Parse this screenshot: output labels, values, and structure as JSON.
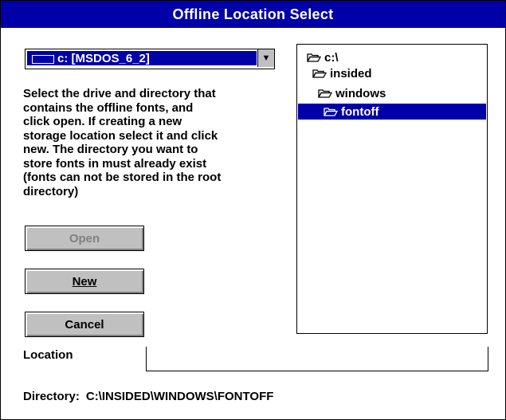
{
  "window": {
    "title": "Offline Location Select"
  },
  "drive": {
    "selected": "c: [MSDOS_6_2]",
    "icon": "drive-icon"
  },
  "instructions": "Select the drive and directory that\ncontains the offline fonts, and\nclick open.  If creating a new\nstorage location select it and click\nnew.  The directory you want to\nstore fonts in must already exist\n(fonts can not be stored in the root\ndirectory)",
  "buttons": {
    "open": "Open",
    "new_label": "New",
    "cancel": "Cancel"
  },
  "tree": [
    {
      "label": "c:\\"
    },
    {
      "label": "insided"
    },
    {
      "label": "windows"
    },
    {
      "label": "fontoff"
    }
  ],
  "location": {
    "label": "Location"
  },
  "directory": {
    "label": "Directory:",
    "value": "C:\\INSIDED\\WINDOWS\\FONTOFF"
  }
}
